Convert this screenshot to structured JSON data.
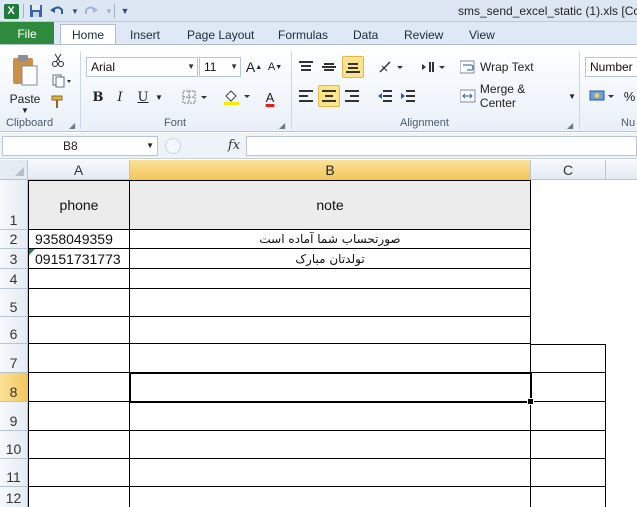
{
  "window": {
    "title": "sms_send_excel_static (1).xls  [Com",
    "logo": "X",
    "quick_access": {
      "save_icon": "save-icon",
      "undo_icon": "undo-icon",
      "redo_icon": "redo-icon",
      "customize_icon": "chevron-down-icon"
    }
  },
  "tabs": [
    {
      "label": "File"
    },
    {
      "label": "Home"
    },
    {
      "label": "Insert"
    },
    {
      "label": "Page Layout"
    },
    {
      "label": "Formulas"
    },
    {
      "label": "Data"
    },
    {
      "label": "Review"
    },
    {
      "label": "View"
    }
  ],
  "ribbon": {
    "clipboard": {
      "label": "Clipboard",
      "paste_label": "Paste"
    },
    "font": {
      "label": "Font",
      "font_name": "Arial",
      "font_size": "11",
      "bold": "B",
      "italic": "I",
      "underline": "U",
      "grow": "A",
      "shrink": "A",
      "font_color_letter": "A"
    },
    "alignment": {
      "label": "Alignment",
      "wrap_text": "Wrap Text",
      "merge_center": "Merge & Center"
    },
    "number": {
      "label": "Nu",
      "format": "Number",
      "percent": "%"
    }
  },
  "formula_bar": {
    "name_box": "B8",
    "fx": "fx",
    "formula": ""
  },
  "grid": {
    "columns": [
      {
        "label": "A"
      },
      {
        "label": "B",
        "selected": true
      },
      {
        "label": "C"
      }
    ],
    "rows": [
      {
        "num": "1",
        "a": "phone",
        "b": "note"
      },
      {
        "num": "2",
        "a": "9358049359",
        "b": "صورتحساب شما آماده است"
      },
      {
        "num": "3",
        "a": "09151731773",
        "b": "تولدتان مبارک"
      },
      {
        "num": "4",
        "a": "",
        "b": ""
      },
      {
        "num": "5",
        "a": "",
        "b": ""
      },
      {
        "num": "6",
        "a": "",
        "b": ""
      },
      {
        "num": "7",
        "a": "",
        "b": ""
      },
      {
        "num": "8",
        "a": "",
        "b": "",
        "selected": true
      },
      {
        "num": "9",
        "a": "",
        "b": ""
      },
      {
        "num": "10",
        "a": "",
        "b": ""
      },
      {
        "num": "11",
        "a": "",
        "b": ""
      },
      {
        "num": "12",
        "a": "",
        "b": ""
      }
    ]
  },
  "colors": {
    "file_tab": "#2e8b3d",
    "selection_header": "#f3c65c",
    "header_fill": "#ececec"
  }
}
